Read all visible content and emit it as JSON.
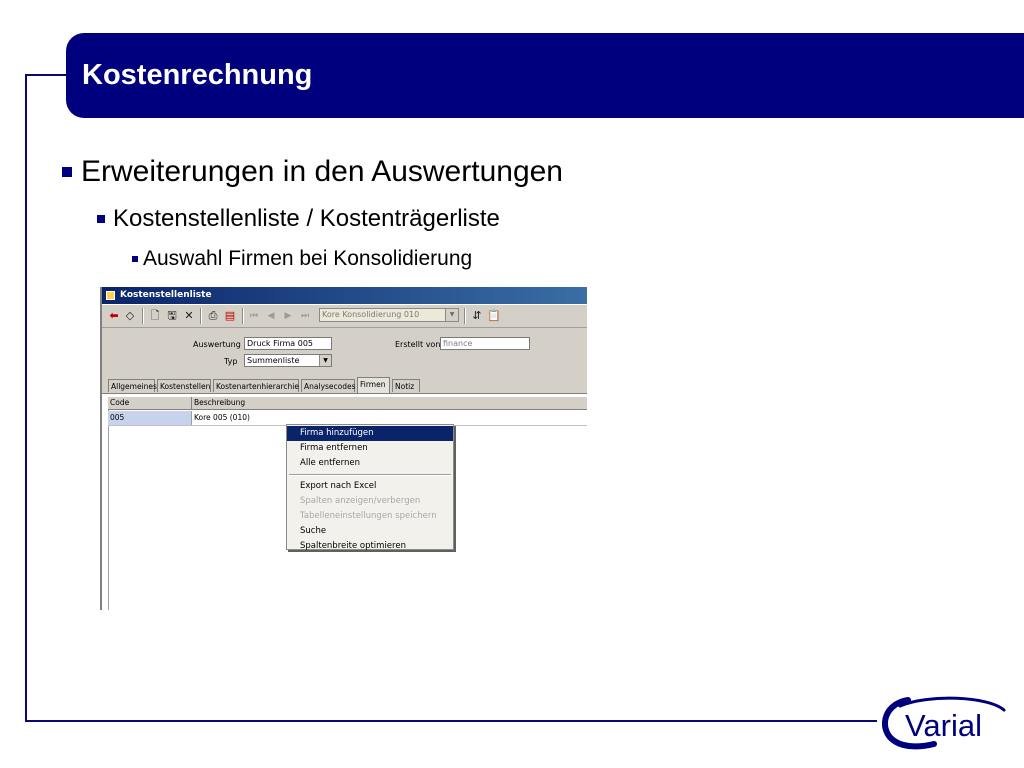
{
  "slide": {
    "title": "Kostenrechnung",
    "bullets": [
      "Erweiterungen in den Auswertungen",
      "Kostenstellenliste / Kostenträgerliste",
      "Auswahl Firmen bei Konsolidierung"
    ],
    "logo_text": "Varial"
  },
  "window": {
    "title": "Kostenstellenliste",
    "toolbar": {
      "icons": [
        "back-arrow-icon",
        "eraser-icon",
        "new-document-icon",
        "save-icon",
        "delete-icon",
        "print-icon",
        "print-preview-icon",
        "first-record-icon",
        "previous-record-icon",
        "next-record-icon",
        "last-record-icon",
        "export-icon",
        "clipboard-icon"
      ],
      "company_combo": "Kore Konsolidierung 010"
    },
    "form": {
      "auswertung_label": "Auswertung",
      "auswertung_value": "Druck Firma 005",
      "typ_label": "Typ",
      "typ_value": "Summenliste",
      "erstellt_label": "Erstellt von",
      "erstellt_value": "finance"
    },
    "tabs": [
      "Allgemeines",
      "Kostenstellen",
      "Kostenartenhierarchie",
      "Analysecodes",
      "Firmen",
      "Notiz"
    ],
    "active_tab": "Firmen",
    "grid": {
      "columns": [
        "Code",
        "Beschreibung"
      ],
      "rows": [
        [
          "005",
          "Kore 005 (010)"
        ]
      ]
    },
    "context_menu": {
      "items": [
        {
          "label": "Firma hinzufügen",
          "state": "highlighted"
        },
        {
          "label": "Firma entfernen",
          "state": "enabled"
        },
        {
          "label": "Alle entfernen",
          "state": "enabled"
        },
        {
          "label": "Export nach Excel",
          "state": "enabled"
        },
        {
          "label": "Spalten anzeigen/verbergen",
          "state": "disabled"
        },
        {
          "label": "Tabelleneinstellungen speichern",
          "state": "disabled"
        },
        {
          "label": "Suche",
          "state": "enabled"
        },
        {
          "label": "Spaltenbreite optimieren",
          "state": "enabled"
        }
      ]
    }
  },
  "colors": {
    "brand_navy": "#00007e",
    "window_title": "#0a246a",
    "selection": "#c7d3ec"
  }
}
